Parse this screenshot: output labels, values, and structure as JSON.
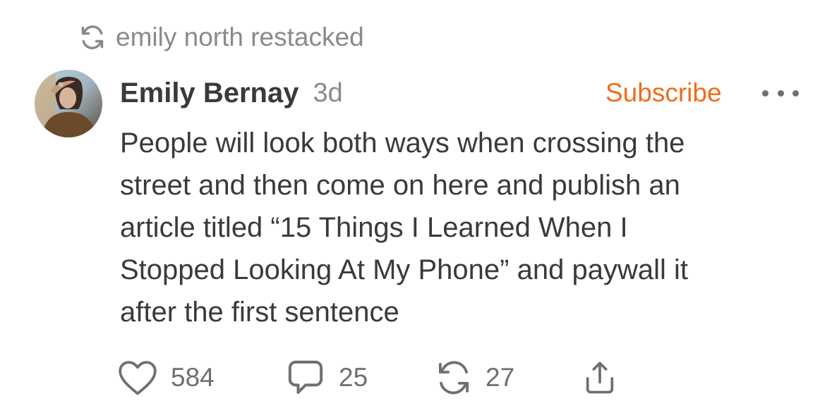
{
  "restack": {
    "icon": "restack-icon",
    "text": "emily north restacked"
  },
  "post": {
    "author": "Emily Bernay",
    "time": "3d",
    "subscribe_label": "Subscribe",
    "more_icon": "more-horizontal-icon",
    "body_lines": [
      "People will look both ways when crossing the",
      "street and then come on here and publish an",
      "article titled “15 Things I Learned When I",
      "Stopped Looking At My Phone” and paywall it",
      "after the first sentence"
    ]
  },
  "actions": {
    "like": {
      "icon": "heart-icon",
      "count": "584"
    },
    "comment": {
      "icon": "comment-icon",
      "count": "25"
    },
    "restack": {
      "icon": "restack-icon",
      "count": "27"
    },
    "share": {
      "icon": "share-icon"
    }
  },
  "colors": {
    "accent": "#f26a1b",
    "text": "#3a3a3c",
    "muted": "#8a8a8e",
    "icon": "#6e6e73"
  }
}
